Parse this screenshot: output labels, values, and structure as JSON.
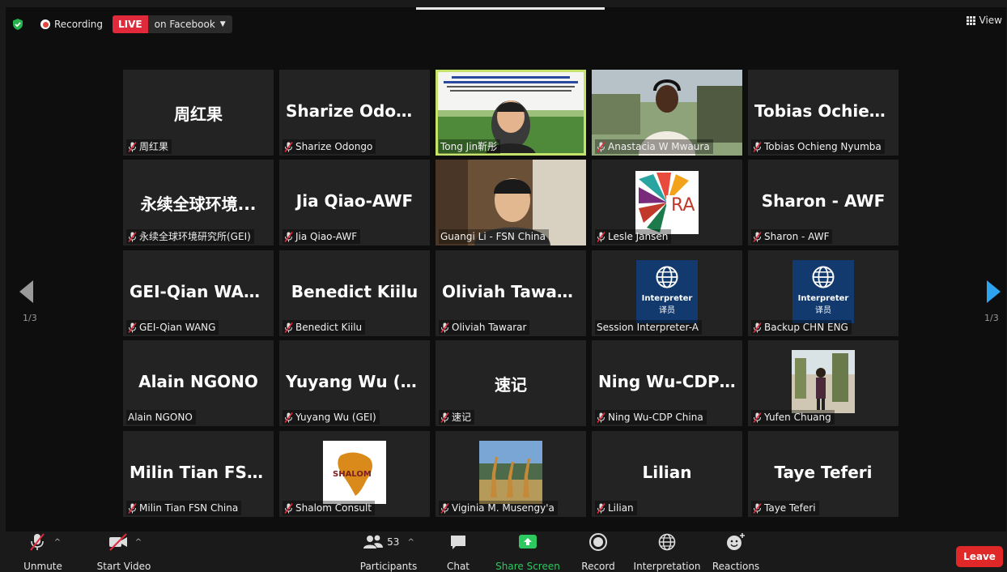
{
  "top": {
    "recording": "Recording",
    "live_badge": "LIVE",
    "live_target": "on Facebook",
    "view_label": "View"
  },
  "pager": {
    "left": "1/3",
    "right": "1/3"
  },
  "tiles": [
    {
      "big": "周红果",
      "name": "周红果",
      "muted": true
    },
    {
      "big": "Sharize Odongo",
      "name": "Sharize Odongo",
      "muted": true
    },
    {
      "big": "",
      "name": "Tong Jin靳彤",
      "muted": false,
      "video": "slide"
    },
    {
      "big": "",
      "name": "Anastacia W Mwaura",
      "muted": true,
      "video": "person-outdoor"
    },
    {
      "big": "Tobias  Ochieng...",
      "name": "Tobias Ochieng Nyumba",
      "muted": true
    },
    {
      "big": "永续全球环境...",
      "name": "永续全球环境研究所(GEI)",
      "muted": true
    },
    {
      "big": "Jia Qiao-AWF",
      "name": "Jia Qiao-AWF",
      "muted": true
    },
    {
      "big": "",
      "name": "Guangi Li - FSN China",
      "muted": false,
      "video": "person-indoor"
    },
    {
      "big": "",
      "name": "Lesle Jansen",
      "muted": true,
      "video": "ra-logo",
      "logo_text": "RA"
    },
    {
      "big": "Sharon - AWF",
      "name": "Sharon - AWF",
      "muted": true
    },
    {
      "big": "GEI-Qian WANG",
      "name": "GEI-Qian WANG",
      "muted": true
    },
    {
      "big": "Benedict Kiilu",
      "name": "Benedict Kiilu",
      "muted": true
    },
    {
      "big": "Oliviah Tawarar",
      "name": "Oliviah Tawarar",
      "muted": true
    },
    {
      "big": "",
      "name": "Session Interpreter-A",
      "muted": false,
      "video": "interp",
      "line1": "Interpreter",
      "line2": "译员"
    },
    {
      "big": "",
      "name": "Backup CHN ENG",
      "muted": true,
      "video": "interp",
      "line1": "Interpreter",
      "line2": "译员"
    },
    {
      "big": "Alain NGONO",
      "name": "Alain NGONO",
      "muted": false
    },
    {
      "big": "Yuyang Wu (GEI)",
      "name": "Yuyang Wu (GEI)",
      "muted": true
    },
    {
      "big": "速记",
      "name": "速记",
      "muted": true
    },
    {
      "big": "Ning Wu-CDP C...",
      "name": "Ning Wu-CDP China",
      "muted": true
    },
    {
      "big": "",
      "name": "Yufen Chuang",
      "muted": true,
      "video": "photo-person"
    },
    {
      "big": "Milin Tian FSN...",
      "name": "Milin Tian FSN China",
      "muted": true
    },
    {
      "big": "",
      "name": "Shalom Consult",
      "muted": true,
      "video": "shalom",
      "logo_text": "SHALOM"
    },
    {
      "big": "",
      "name": "Viginia M. Musengy'a",
      "muted": true,
      "video": "giraffes"
    },
    {
      "big": "Lilian",
      "name": "Lilian",
      "muted": true
    },
    {
      "big": "Taye Teferi",
      "name": "Taye Teferi",
      "muted": true
    }
  ],
  "toolbar": {
    "unmute": "Unmute",
    "start_video": "Start Video",
    "participants": "Participants",
    "participants_count": "53",
    "chat": "Chat",
    "share_screen": "Share Screen",
    "record": "Record",
    "interpretation": "Interpretation",
    "reactions": "Reactions",
    "leave": "Leave"
  },
  "colors": {
    "share_green": "#2ec860",
    "leave_red": "#e02828",
    "live_red": "#e0293a",
    "active_outline": "#c5e36b",
    "nav_blue": "#2da4f0"
  }
}
